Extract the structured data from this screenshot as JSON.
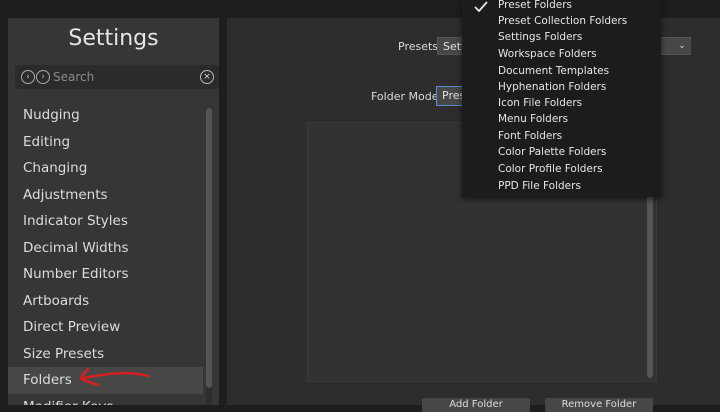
{
  "sidebar": {
    "title": "Settings",
    "search_placeholder": "Search",
    "items": [
      {
        "label": "Nudging"
      },
      {
        "label": "Editing"
      },
      {
        "label": "Changing"
      },
      {
        "label": "Adjustments"
      },
      {
        "label": "Indicator Styles"
      },
      {
        "label": "Decimal Widths"
      },
      {
        "label": "Number Editors"
      },
      {
        "label": "Artboards"
      },
      {
        "label": "Direct Preview"
      },
      {
        "label": "Size Presets"
      },
      {
        "label": "Folders"
      },
      {
        "label": "Modifier Keys"
      }
    ],
    "selected": "Folders"
  },
  "main": {
    "presets_label": "Presets",
    "presets_value": "Sett",
    "folder_mode_label": "Folder Mode",
    "folder_mode_value": "Prese",
    "add_button": "Add Folder",
    "remove_button": "Remove Folder"
  },
  "dropdown": {
    "checked": "Preset Folders",
    "items": [
      "Preset Folders",
      "Preset Collection Folders",
      "Settings Folders",
      "Workspace Folders",
      "Document Templates",
      "Hyphenation Folders",
      "Icon File Folders",
      "Menu Folders",
      "Font Folders",
      "Color Palette Folders",
      "Color Profile Folders",
      "PPD File Folders"
    ]
  },
  "colors": {
    "annotation": "#d42020",
    "focus": "#5b8ad8"
  }
}
